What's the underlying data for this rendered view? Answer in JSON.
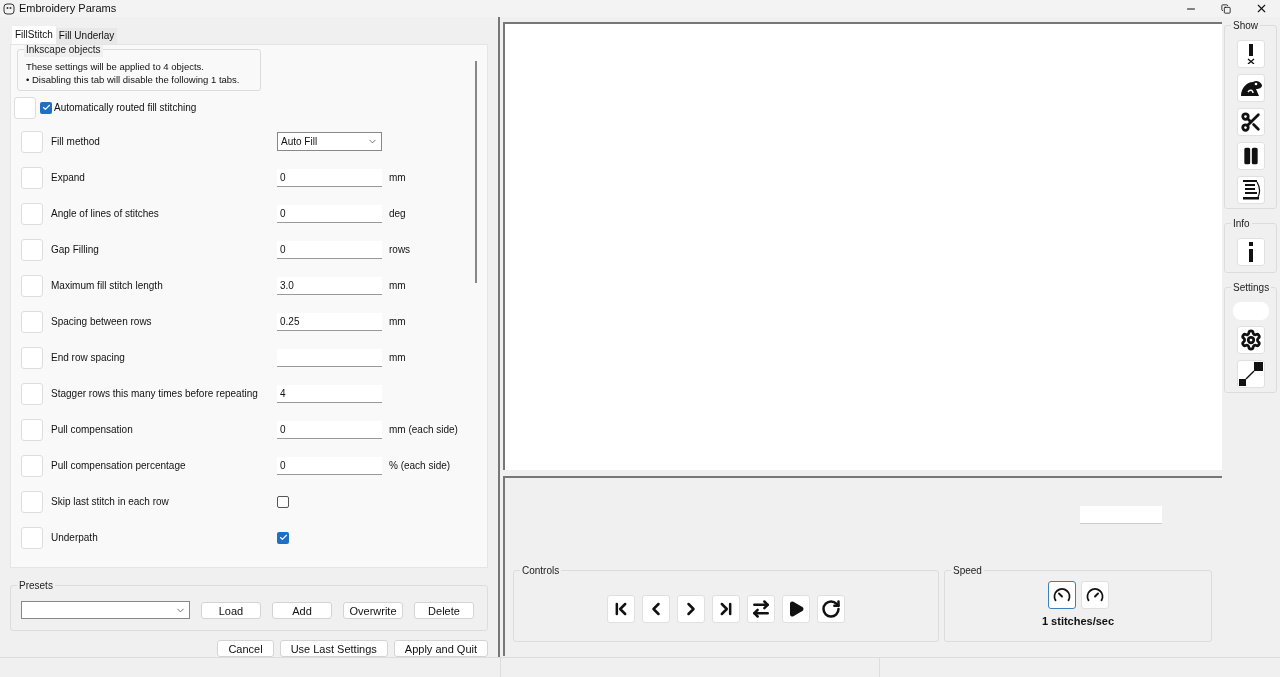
{
  "window": {
    "title": "Embroidery Params"
  },
  "tabs": [
    {
      "label": "FillStitch",
      "selected": true
    },
    {
      "label": "Fill Underlay",
      "selected": false
    }
  ],
  "info_group": {
    "title": "Inkscape objects",
    "lines": [
      "These settings will be applied to 4 objects.",
      "• Disabling this tab will disable the following 1 tabs."
    ]
  },
  "auto_route": {
    "label": "Automatically routed fill stitching",
    "checked": true
  },
  "params": [
    {
      "kind": "dropdown",
      "label": "Fill method",
      "value": "Auto Fill"
    },
    {
      "kind": "text",
      "label": "Expand",
      "value": "0",
      "unit": "mm"
    },
    {
      "kind": "text",
      "label": "Angle of lines of stitches",
      "value": "0",
      "unit": "deg"
    },
    {
      "kind": "text",
      "label": "Gap Filling",
      "value": "0",
      "unit": "rows"
    },
    {
      "kind": "text",
      "label": "Maximum fill stitch length",
      "value": "3.0",
      "unit": "mm"
    },
    {
      "kind": "text",
      "label": "Spacing between rows",
      "value": "0.25",
      "unit": "mm"
    },
    {
      "kind": "text",
      "label": "End row spacing",
      "unit": "mm"
    },
    {
      "kind": "text",
      "label": "Stagger rows this many times before repeating",
      "value": "4"
    },
    {
      "kind": "text",
      "label": "Pull compensation",
      "value": "0",
      "unit": "mm (each side)"
    },
    {
      "kind": "text",
      "label": "Pull compensation percentage",
      "value": "0",
      "unit": "% (each side)"
    },
    {
      "kind": "checkbox",
      "label": "Skip last stitch in each row",
      "checked": false
    },
    {
      "kind": "checkbox",
      "label": "Underpath",
      "checked": true
    }
  ],
  "presets": {
    "title": "Presets",
    "buttons": [
      "Load",
      "Add",
      "Overwrite",
      "Delete"
    ]
  },
  "footer_buttons": [
    "Cancel",
    "Use Last Settings",
    "Apply and Quit"
  ],
  "controls": {
    "title": "Controls"
  },
  "speed": {
    "title": "Speed",
    "buttons": [
      {
        "selected": true
      },
      {
        "selected": false
      }
    ],
    "reading": "1 stitches/sec"
  },
  "sidebar": {
    "show_title": "Show",
    "info_title": "Info",
    "settings_title": "Settings"
  }
}
